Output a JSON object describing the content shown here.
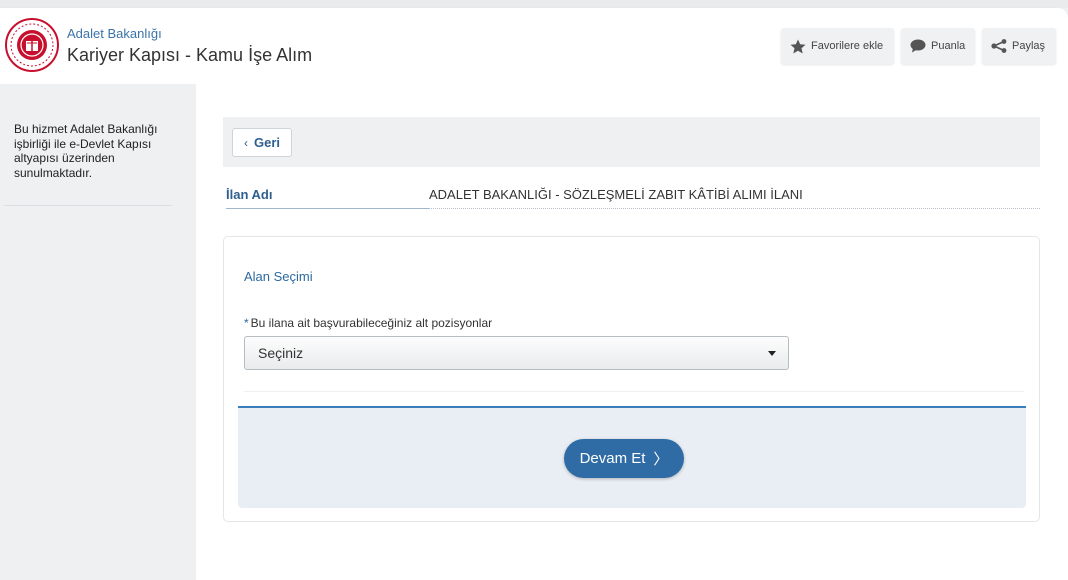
{
  "header": {
    "org_name": "Adalet Bakanlığı",
    "service_title": "Kariyer Kapısı - Kamu İşe Alım",
    "buttons": {
      "favorite": "Favorilere ekle",
      "rate": "Puanla",
      "share": "Paylaş"
    }
  },
  "sidebar": {
    "note": "Bu hizmet Adalet Bakanlığı işbirliği ile e-Devlet Kapısı altyapısı üzerinden sunulmaktadır."
  },
  "main": {
    "back_label": "Geri",
    "back_chevron": "‹",
    "listing": {
      "label": "İlan Adı",
      "value": "ADALET BAKANLIĞI - SÖZLEŞMELİ ZABIT KÂTİBİ ALIMI İLANI"
    },
    "section_title": "Alan Seçimi",
    "field": {
      "required_mark": "*",
      "label": "Bu ilana ait başvurabileceğiniz alt pozisyonlar",
      "selected": "Seçiniz"
    },
    "continue_label": "Devam Et",
    "continue_chevron": "〉"
  },
  "icons": {
    "logo": "ministry-of-justice-emblem",
    "favorite": "star-icon",
    "rate": "speech-bubble-icon",
    "share": "share-icon",
    "back": "chevron-left-icon",
    "select": "caret-down-icon",
    "continue": "chevron-right-icon"
  },
  "colors": {
    "accent": "#2f6ca6",
    "link": "#3a73a8",
    "logo_red": "#c8102e"
  }
}
